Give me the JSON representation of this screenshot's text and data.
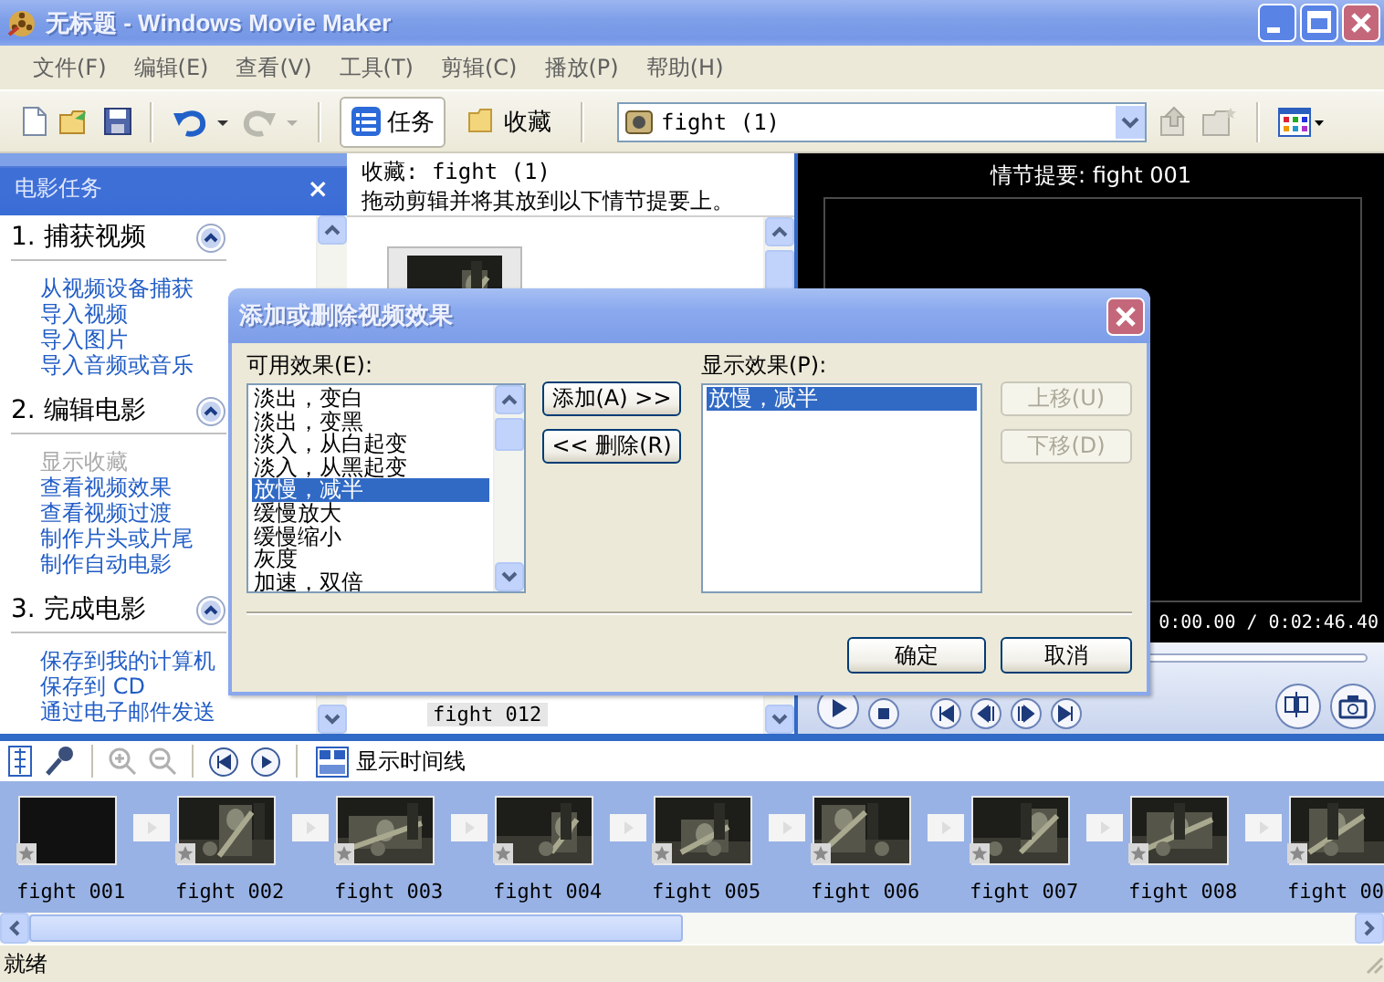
{
  "window": {
    "title": "无标题 - Windows Movie Maker"
  },
  "menu": [
    "文件(F)",
    "编辑(E)",
    "查看(V)",
    "工具(T)",
    "剪辑(C)",
    "播放(P)",
    "帮助(H)"
  ],
  "toolbar": {
    "tabs": [
      {
        "label": "任务",
        "selected": true
      },
      {
        "label": "收藏",
        "selected": false
      }
    ],
    "collection": "fight (1)"
  },
  "task_pane": {
    "title": "电影任务",
    "close": "×",
    "sections": [
      {
        "heading": "1. 捕获视频",
        "expanded": true,
        "links": [
          {
            "label": "从视频设备捕获",
            "disabled": false
          },
          {
            "label": "导入视频",
            "disabled": false
          },
          {
            "label": "导入图片",
            "disabled": false
          },
          {
            "label": "导入音频或音乐",
            "disabled": false
          }
        ]
      },
      {
        "heading": "2. 编辑电影",
        "expanded": true,
        "links": [
          {
            "label": "显示收藏",
            "disabled": true
          },
          {
            "label": "查看视频效果",
            "disabled": false
          },
          {
            "label": "查看视频过渡",
            "disabled": false
          },
          {
            "label": "制作片头或片尾",
            "disabled": false
          },
          {
            "label": "制作自动电影",
            "disabled": false
          }
        ]
      },
      {
        "heading": "3. 完成电影",
        "expanded": true,
        "links": [
          {
            "label": "保存到我的计算机",
            "disabled": false
          },
          {
            "label": "保存到 CD",
            "disabled": false
          },
          {
            "label": "通过电子邮件发送",
            "disabled": false
          }
        ]
      }
    ]
  },
  "collection": {
    "title": "收藏: fight (1)",
    "hint": "拖动剪辑并将其放到以下情节提要上。",
    "clip_label": "fight 012"
  },
  "monitor": {
    "title": "情节提要: fight 001",
    "time": "0:00.00 / 0:02:46.40"
  },
  "dialog": {
    "title": "添加或删除视频效果",
    "available_label": "可用效果(E):",
    "available": [
      {
        "label": "淡出，变白",
        "selected": false
      },
      {
        "label": "淡出，变黑",
        "selected": false
      },
      {
        "label": "淡入，从白起变",
        "selected": false
      },
      {
        "label": "淡入，从黑起变",
        "selected": false
      },
      {
        "label": "放慢，减半",
        "selected": true
      },
      {
        "label": "缓慢放大",
        "selected": false
      },
      {
        "label": "缓慢缩小",
        "selected": false
      },
      {
        "label": "灰度",
        "selected": false
      },
      {
        "label": "加速，双倍",
        "selected": false
      }
    ],
    "add_button": "添加(A) >>",
    "remove_button": "<< 删除(R)",
    "shown_label": "显示效果(P):",
    "shown": [
      {
        "label": "放慢，减半",
        "selected": true
      }
    ],
    "move_buttons": [
      {
        "label": "上移(U)",
        "disabled": true
      },
      {
        "label": "下移(D)",
        "disabled": true
      }
    ],
    "ok": "确定",
    "cancel": "取消"
  },
  "storyboard": {
    "timeline_button": "显示时间线",
    "clips": [
      {
        "label": "fight 001",
        "kind": "blank"
      },
      {
        "label": "fight 002",
        "kind": "picture"
      },
      {
        "label": "fight 003",
        "kind": "picture"
      },
      {
        "label": "fight 004",
        "kind": "picture"
      },
      {
        "label": "fight 005",
        "kind": "picture"
      },
      {
        "label": "fight 006",
        "kind": "picture"
      },
      {
        "label": "fight 007",
        "kind": "picture"
      },
      {
        "label": "fight 008",
        "kind": "picture"
      },
      {
        "label": "fight 00",
        "kind": "picture"
      }
    ]
  },
  "status_bar": {
    "text": "就绪"
  }
}
